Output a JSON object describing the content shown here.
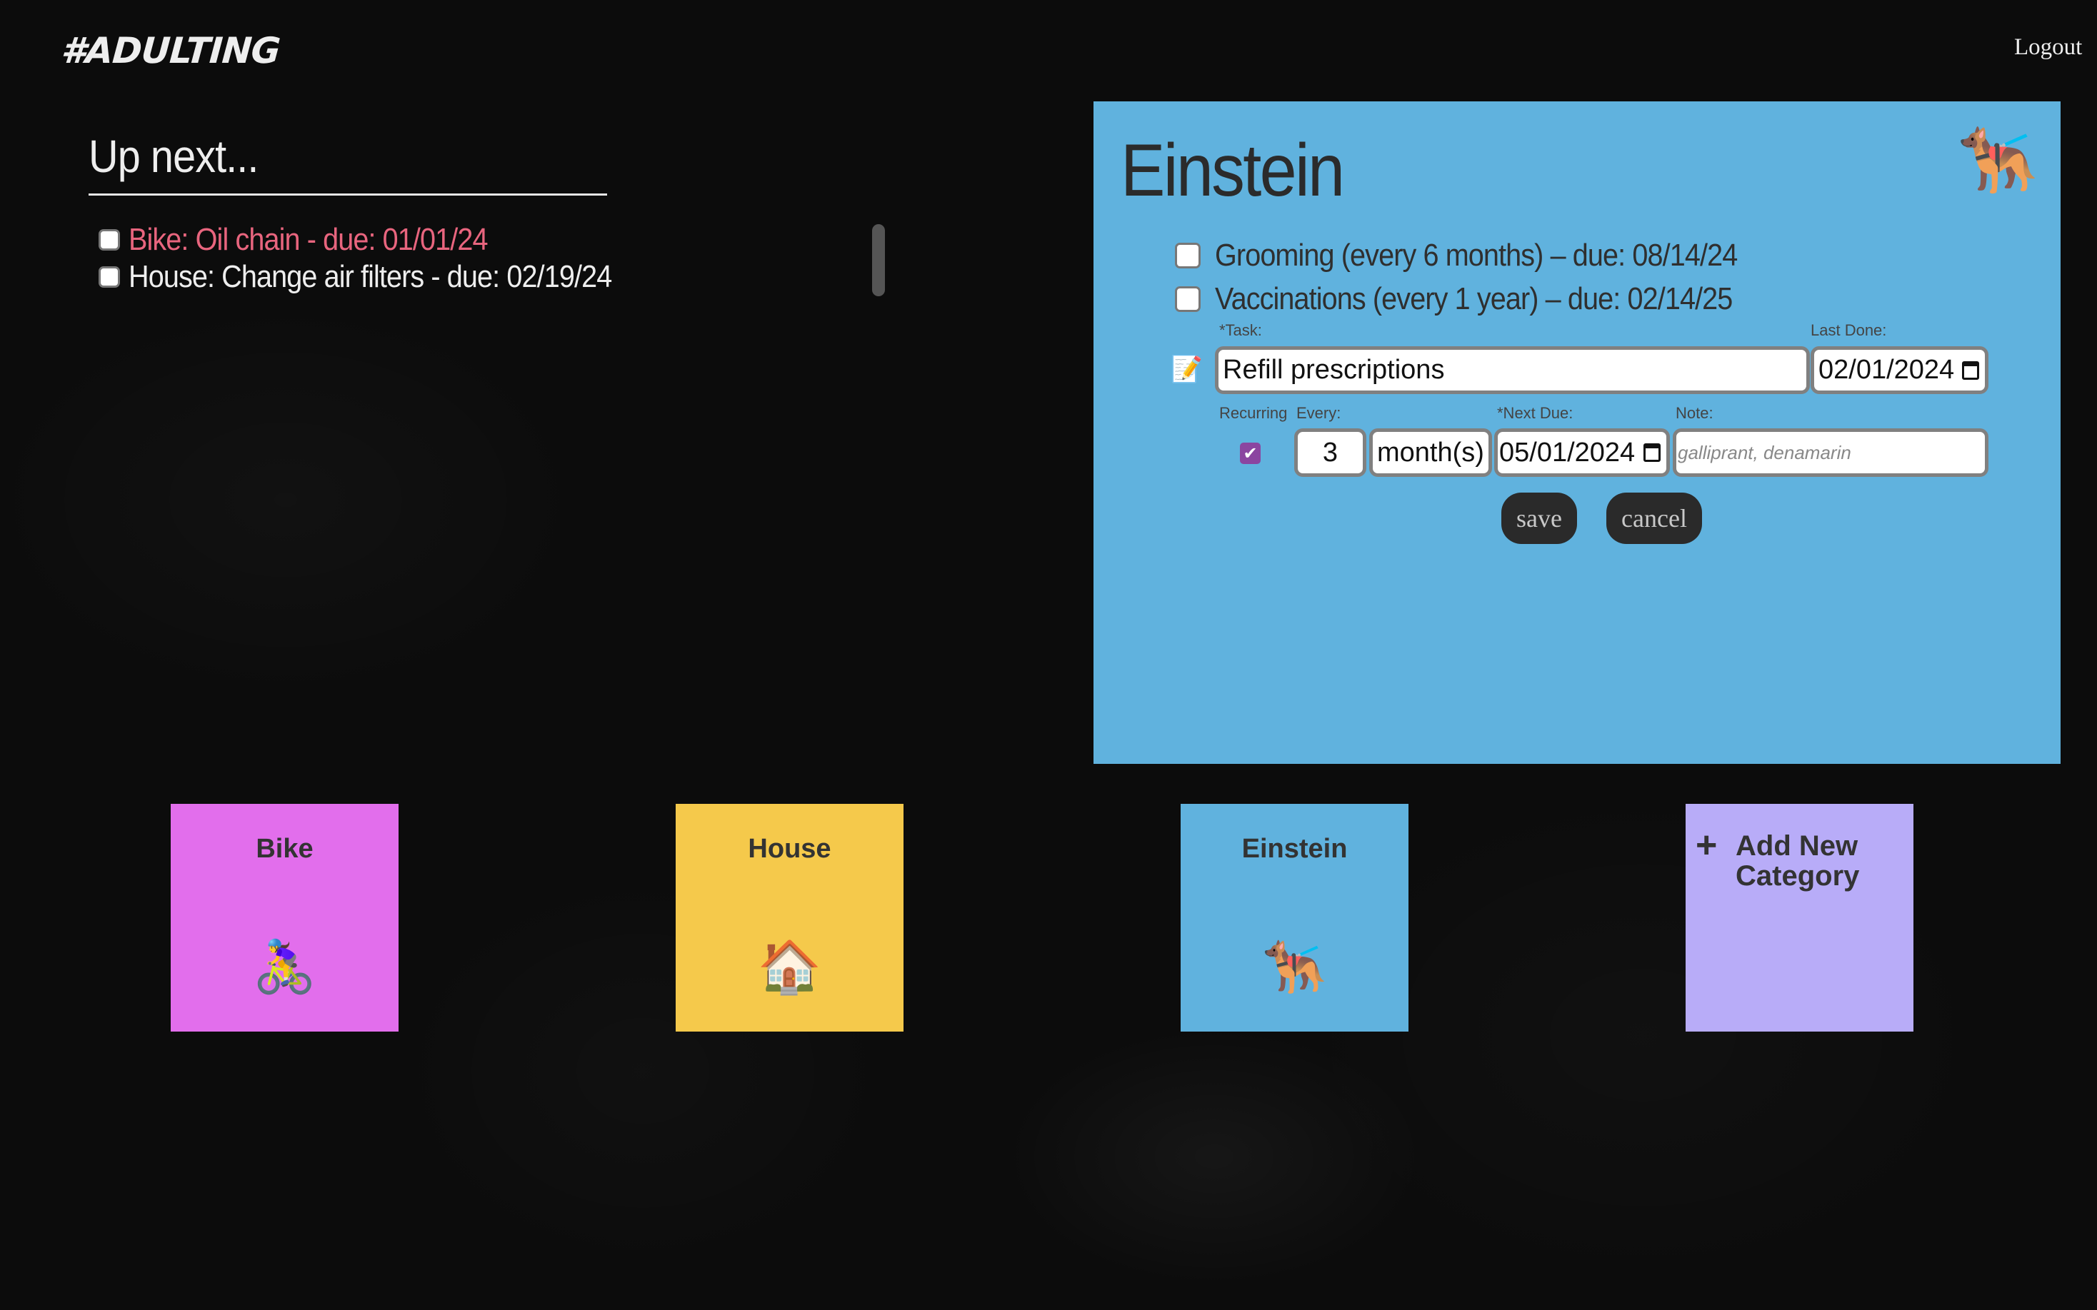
{
  "header": {
    "logo": "#ADULTING",
    "logout_label": "Logout"
  },
  "up_next": {
    "title": "Up next...",
    "items": [
      {
        "label": "Bike: Oil chain - due: 01/01/24",
        "overdue": true,
        "checked": false
      },
      {
        "label": "House: Change air filters - due: 02/19/24",
        "overdue": false,
        "checked": false
      }
    ]
  },
  "panel": {
    "title": "Einstein",
    "icon": "🐕‍🦺",
    "icon_name": "service-dog-icon",
    "tasks": [
      {
        "label": "Grooming (every 6 months)   –  due: 08/14/24",
        "checked": false
      },
      {
        "label": "Vaccinations (every 1 year)   –  due: 02/14/25",
        "checked": false
      }
    ],
    "form": {
      "edit_icon": "📝",
      "task_label": "*Task:",
      "task_value": "Refill prescriptions",
      "last_done_label": "Last Done:",
      "last_done_value": "02/01/2024",
      "recurring_label": "Recurring",
      "recurring_checked": true,
      "every_label": "Every:",
      "every_value": "3",
      "unit_value": "month(s)",
      "next_due_label": "*Next Due:",
      "next_due_value": "05/01/2024",
      "note_label": "Note:",
      "note_placeholder": "galliprant, denamarin",
      "save_label": "save",
      "cancel_label": "cancel"
    }
  },
  "categories": [
    {
      "name": "Bike",
      "emoji": "🚴‍♀️",
      "color": "#e26eec"
    },
    {
      "name": "House",
      "emoji": "🏠",
      "color": "#f5c94b"
    },
    {
      "name": "Einstein",
      "emoji": "🐕‍🦺",
      "color": "#60b2de"
    }
  ],
  "add_category": {
    "plus": "+",
    "label": "Add New Category",
    "color": "#b8acf8"
  },
  "colors": {
    "overdue": "#e8657e",
    "panel_bg": "#60b2de",
    "button_bg": "#2a2a2a",
    "checkbox_accent": "#8b45a0"
  }
}
